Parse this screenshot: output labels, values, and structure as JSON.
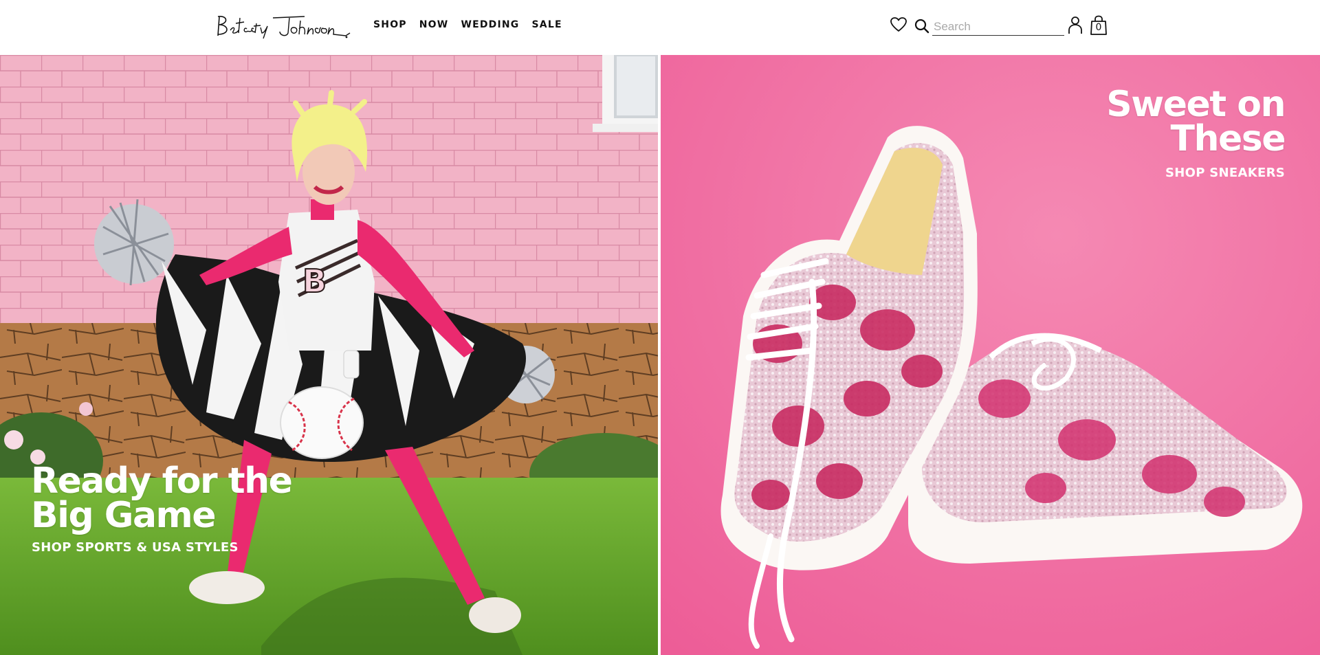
{
  "header": {
    "logo_text": "Betsey Johnson",
    "nav": [
      {
        "label": "SHOP"
      },
      {
        "label": "NOW"
      },
      {
        "label": "WEDDING"
      },
      {
        "label": "SALE"
      }
    ],
    "search": {
      "placeholder": "Search",
      "value": ""
    },
    "bag_count": "0",
    "icons": [
      "heart-icon",
      "search-icon",
      "account-icon",
      "bag-icon"
    ]
  },
  "hero_left": {
    "headline_line1": "Ready for the",
    "headline_line2": "Big Game",
    "cta": "SHOP SPORTS & USA STYLES",
    "image_alt": "Cheerleader in pink and black outfit with baseball bag"
  },
  "hero_right": {
    "headline_line1": "Sweet on",
    "headline_line2": "These",
    "cta": "SHOP SNEAKERS",
    "image_alt": "Pink rhinestone lip sneakers on pink background"
  },
  "colors": {
    "hot_pink_bg": "#f0679f",
    "wall_pink": "#f3b4c8",
    "grass": "#6fae2e",
    "text_dark": "#111111"
  }
}
